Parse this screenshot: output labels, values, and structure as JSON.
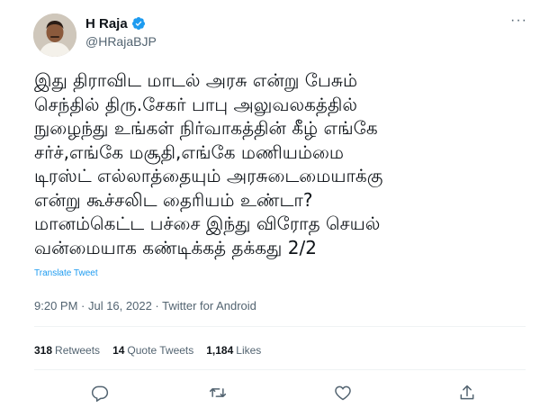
{
  "author": {
    "name": "H Raja",
    "handle": "@HRajaBJP",
    "verified": true
  },
  "tweet": {
    "lines": [
      "இது திராவிட மாடல் அரசு என்று பேசும்",
      "செந்தில் திரு.சேகர் பாபு அலுவலகத்தில்",
      "நுழைந்து உங்கள் நிர்வாகத்தின் கீழ் எங்கே",
      "சர்ச்,எங்கே மசூதி,எங்கே மணியம்மை",
      "டிரஸ்ட் எல்லாத்தையும் அரசுடைமையாக்கு",
      "என்று கூச்சலிட தைரியம் உண்டா?",
      "மானம்கெட்ட பச்சை இந்து விரோத செயல்",
      "வன்மையாக கண்டிக்கத் தக்கது 2/2"
    ],
    "translate_label": "Translate Tweet",
    "timestamp": "9:20 PM · Jul 16, 2022 · Twitter for Android"
  },
  "stats": {
    "retweets_count": "318",
    "retweets_label": "Retweets",
    "quotes_count": "14",
    "quotes_label": "Quote Tweets",
    "likes_count": "1,184",
    "likes_label": "Likes"
  },
  "actions": {
    "reply_icon": "reply-icon",
    "retweet_icon": "retweet-icon",
    "like_icon": "heart-icon",
    "share_icon": "share-icon"
  },
  "more_label": "···",
  "colors": {
    "accent": "#1d9bf0",
    "text": "#0f1419",
    "secondary": "#536471",
    "divider": "#eff3f4"
  }
}
